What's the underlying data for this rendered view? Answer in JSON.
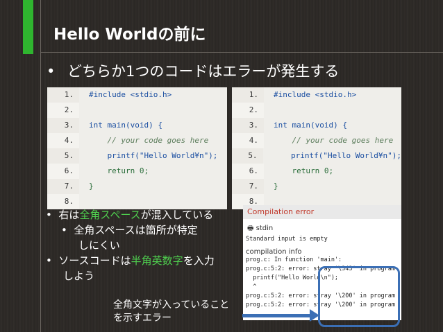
{
  "slide": {
    "title": "Hello Worldの前に",
    "bullet_main": "どちらか1つのコードはエラーが発生する",
    "bullet_dot": "•"
  },
  "code_left": {
    "lines": [
      {
        "num": "1.",
        "text": "#include <stdio.h>"
      },
      {
        "num": "2.",
        "text": ""
      },
      {
        "num": "3.",
        "text": "int main(void) {"
      },
      {
        "num": "4.",
        "text": "    // your code goes here"
      },
      {
        "num": "5.",
        "text": "    printf(\"Hello World¥n\");"
      },
      {
        "num": "6.",
        "text": "    return 0;"
      },
      {
        "num": "7.",
        "text": "}"
      },
      {
        "num": "8.",
        "text": ""
      }
    ]
  },
  "code_right": {
    "lines": [
      {
        "num": "1.",
        "text": "#include <stdio.h>"
      },
      {
        "num": "2.",
        "text": ""
      },
      {
        "num": "3.",
        "text": "int main(void) {"
      },
      {
        "num": "4.",
        "text": "    // your code goes here"
      },
      {
        "num": "5.",
        "text": "    printf(\"Hello World¥n\");"
      },
      {
        "num": "6.",
        "text": "    return 0;"
      },
      {
        "num": "7.",
        "text": "}"
      },
      {
        "num": "8.",
        "text": ""
      }
    ]
  },
  "sub_list": {
    "item1_pre": "右は",
    "item1_hl": "全角スペース",
    "item1_post": "が混入している",
    "item2_line1": "全角スペースは箇所が特定",
    "item2_line2": "しにくい",
    "item3_pre": "ソースコードは",
    "item3_hl": "半角英数字",
    "item3_post": "を入力",
    "item3_line2": "しよう"
  },
  "error_panel": {
    "header": "Compilation error",
    "stdin_label": "stdin",
    "stdin_text": "Standard input is empty",
    "info_label": "compilation info",
    "lines": [
      "prog.c: In function 'main':",
      "prog.c:5:2: error: stray '\\343' in program",
      "  printf(\"Hello World\\n\");",
      "  ^",
      "prog.c:5:2: error: stray '\\200' in program",
      "prog.c:5:2: error: stray '\\200' in program"
    ]
  },
  "caption": {
    "line1": "全角文字が入っていること",
    "line2": "を示すエラー"
  },
  "colors": {
    "accent_green": "#2fb52f",
    "highlight_green": "#4fd04f",
    "arrow_blue": "#3b6fb5",
    "error_red": "#c0392b"
  }
}
